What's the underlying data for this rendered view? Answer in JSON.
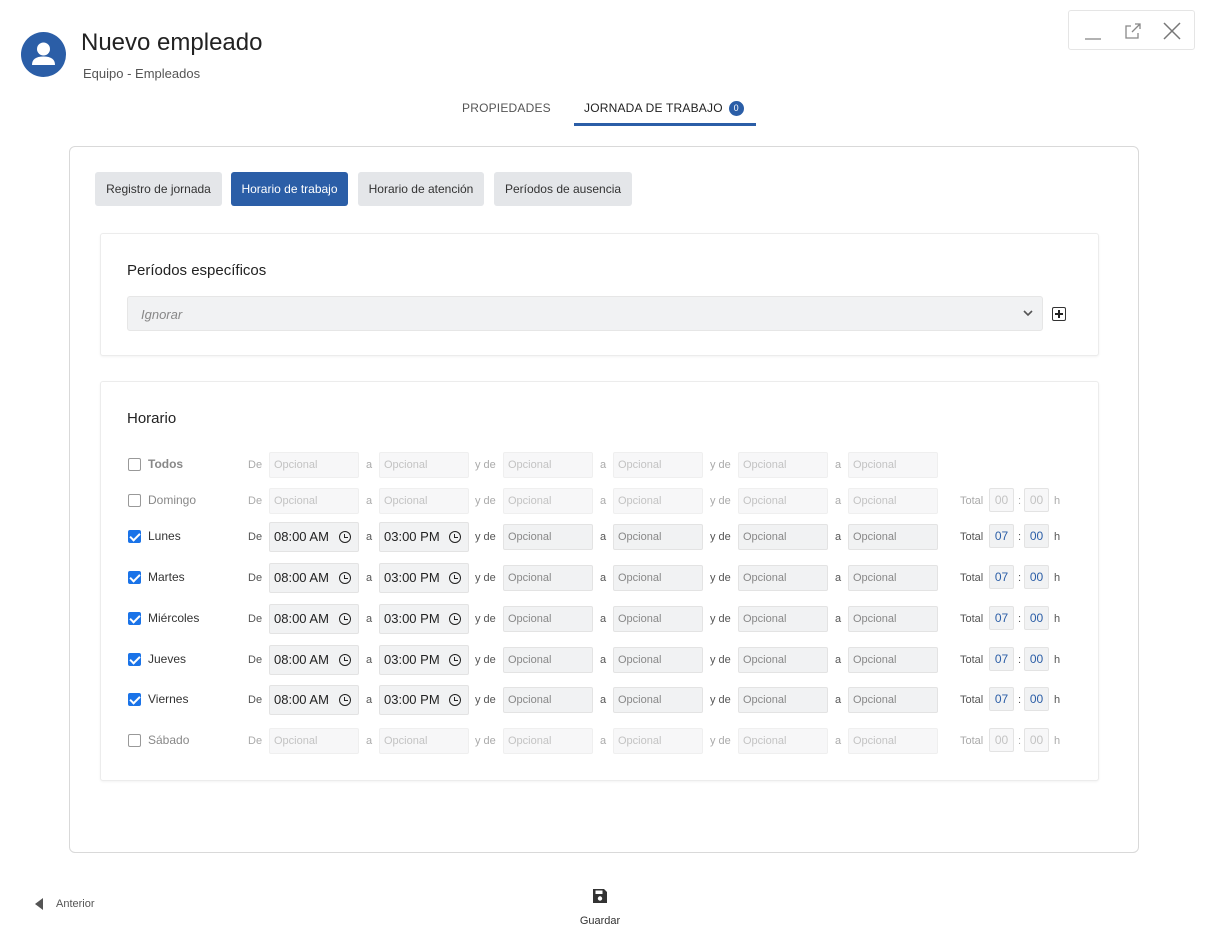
{
  "header": {
    "title": "Nuevo empleado",
    "breadcrumb": "Equipo - Empleados",
    "avatar_icon": "user-icon"
  },
  "window_controls": [
    "minimize-icon",
    "external-link-icon",
    "close-icon"
  ],
  "main_tabs": [
    {
      "label": "PROPIEDADES",
      "active": false
    },
    {
      "label": "JORNADA DE TRABAJO",
      "active": true,
      "badge": "0"
    }
  ],
  "sub_tabs": [
    {
      "label": "Registro de jornada",
      "active": false
    },
    {
      "label": "Horario de trabajo",
      "active": true
    },
    {
      "label": "Horario de atención",
      "active": false
    },
    {
      "label": "Períodos de ausencia",
      "active": false
    }
  ],
  "specific_periods": {
    "title": "Períodos específicos",
    "select_value": "Ignorar",
    "add_icon": "plus-square-icon"
  },
  "schedule": {
    "title": "Horario",
    "labels": {
      "from": "De",
      "to": "a",
      "and_from": "y de",
      "total": "Total",
      "hours": "h",
      "sep": ":"
    },
    "placeholder": "Opcional",
    "days": [
      {
        "name": "Todos",
        "checked": false,
        "from1": "",
        "to1": "",
        "total": null
      },
      {
        "name": "Domingo",
        "checked": false,
        "from1": "",
        "to1": "",
        "total": {
          "h": "00",
          "m": "00"
        }
      },
      {
        "name": "Lunes",
        "checked": true,
        "from1": "08:00 AM",
        "to1": "03:00 PM",
        "total": {
          "h": "07",
          "m": "00"
        }
      },
      {
        "name": "Martes",
        "checked": true,
        "from1": "08:00 AM",
        "to1": "03:00 PM",
        "total": {
          "h": "07",
          "m": "00"
        }
      },
      {
        "name": "Miércoles",
        "checked": true,
        "from1": "08:00 AM",
        "to1": "03:00 PM",
        "total": {
          "h": "07",
          "m": "00"
        }
      },
      {
        "name": "Jueves",
        "checked": true,
        "from1": "08:00 AM",
        "to1": "03:00 PM",
        "total": {
          "h": "07",
          "m": "00"
        }
      },
      {
        "name": "Viernes",
        "checked": true,
        "from1": "08:00 AM",
        "to1": "03:00 PM",
        "total": {
          "h": "07",
          "m": "00"
        }
      },
      {
        "name": "Sábado",
        "checked": false,
        "from1": "",
        "to1": "",
        "total": {
          "h": "00",
          "m": "00"
        }
      }
    ]
  },
  "footer": {
    "prev_label": "Anterior",
    "save_label": "Guardar",
    "prev_icon": "caret-left-icon",
    "save_icon": "floppy-disk-icon"
  },
  "colors": {
    "accent": "#2b5ea7",
    "checkbox": "#1a73e8"
  }
}
